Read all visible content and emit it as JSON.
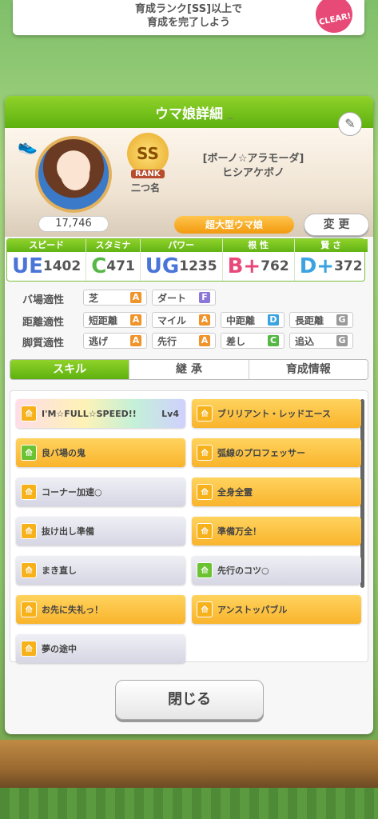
{
  "top_banner": {
    "line1": "育成ランク[SS]以上で",
    "line2": "育成を完了しよう",
    "badge": "CLEAR!"
  },
  "panel": {
    "title": "ウマ娘詳細"
  },
  "profile": {
    "fans": "17,746",
    "rank": "SS",
    "rank_label": "RANK",
    "rank_name": "二つ名",
    "title": "[ボーノ☆アラモーダ]",
    "name": "ヒシアケボノ",
    "type": "超大型ウマ娘",
    "change_label": "変 更",
    "dash": "–"
  },
  "stats": [
    {
      "label": "スピード",
      "grade": "UE",
      "value": "1402",
      "color": "#4a74d8"
    },
    {
      "label": "スタミナ",
      "grade": "C",
      "value": "471",
      "color": "#55b845"
    },
    {
      "label": "パワー",
      "grade": "UG",
      "value": "1235",
      "color": "#4a74d8"
    },
    {
      "label": "根 性",
      "grade": "B+",
      "value": "762",
      "color": "#e8497a"
    },
    {
      "label": "賢 さ",
      "grade": "D+",
      "value": "372",
      "color": "#3aa3e0"
    }
  ],
  "aptitude": {
    "track_label": "バ場適性",
    "distance_label": "距離適性",
    "style_label": "脚質適性",
    "track": [
      {
        "name": "芝",
        "grade": "A",
        "color": "#f1932b"
      },
      {
        "name": "ダート",
        "grade": "F",
        "color": "#8c77d9"
      }
    ],
    "distance": [
      {
        "name": "短距離",
        "grade": "A",
        "color": "#f1932b"
      },
      {
        "name": "マイル",
        "grade": "A",
        "color": "#f1932b"
      },
      {
        "name": "中距離",
        "grade": "D",
        "color": "#3aa3e0"
      },
      {
        "name": "長距離",
        "grade": "G",
        "color": "#999999"
      }
    ],
    "style": [
      {
        "name": "逃げ",
        "grade": "A",
        "color": "#f1932b"
      },
      {
        "name": "先行",
        "grade": "A",
        "color": "#f1932b"
      },
      {
        "name": "差し",
        "grade": "C",
        "color": "#55b845"
      },
      {
        "name": "追込",
        "grade": "G",
        "color": "#999999"
      }
    ]
  },
  "tabs": [
    {
      "label": "スキル"
    },
    {
      "label": "継 承"
    },
    {
      "label": "育成情報"
    }
  ],
  "skills": [
    {
      "name": "I'M☆FULL☆SPEED!!",
      "level": "Lv4",
      "style": "rainbow",
      "icon": "running-icon"
    },
    {
      "name": "ブリリアント・レッドエース",
      "level": "",
      "style": "gold",
      "icon": "running-icon"
    },
    {
      "name": "良バ場の鬼",
      "level": "",
      "style": "gold",
      "icon": "field-icon"
    },
    {
      "name": "弧線のプロフェッサー",
      "level": "",
      "style": "gold",
      "icon": "running-icon"
    },
    {
      "name": "コーナー加速○",
      "level": "",
      "style": "normal",
      "icon": "running-icon"
    },
    {
      "name": "全身全霊",
      "level": "",
      "style": "gold",
      "icon": "running-icon"
    },
    {
      "name": "抜け出し準備",
      "level": "",
      "style": "normal",
      "icon": "running-icon"
    },
    {
      "name": "準備万全！",
      "level": "",
      "style": "gold",
      "icon": "running-icon"
    },
    {
      "name": "まき直し",
      "level": "",
      "style": "normal",
      "icon": "running-icon"
    },
    {
      "name": "先行のコツ○",
      "level": "",
      "style": "normal",
      "icon": "style-icon"
    },
    {
      "name": "お先に失礼っ！",
      "level": "",
      "style": "gold",
      "icon": "running-icon"
    },
    {
      "name": "アンストッパブル",
      "level": "",
      "style": "gold",
      "icon": "running-icon"
    },
    {
      "name": "夢の途中",
      "level": "",
      "style": "normal",
      "icon": "running-icon"
    }
  ],
  "close_label": "閉じる"
}
